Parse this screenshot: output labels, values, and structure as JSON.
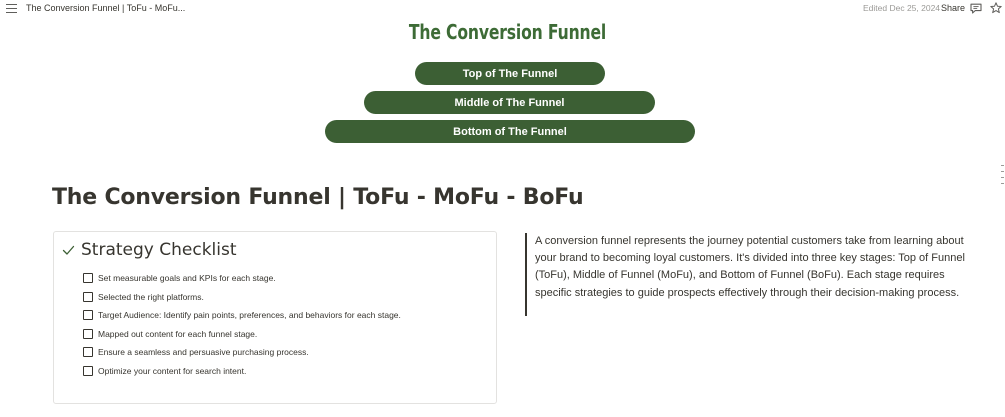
{
  "topbar": {
    "page_name": "The Conversion Funnel | ToFu - MoFu...",
    "edited": "Edited Dec 25, 2024",
    "share_label": "Share",
    "icons": [
      "menu-icon",
      "comment-icon",
      "star-icon"
    ]
  },
  "hero": {
    "title": "The Conversion Funnel",
    "funnel": {
      "top": "Top of The Funnel",
      "middle": "Middle of The Funnel",
      "bottom": "Bottom of The Funnel"
    }
  },
  "page": {
    "title": "The Conversion Funnel | ToFu - MoFu - BoFu"
  },
  "checklist": {
    "title": "Strategy Checklist",
    "items": [
      "Set measurable goals and KPIs for each stage.",
      "Selected the right platforms.",
      "Target Audience: Identify pain points, preferences, and behaviors for each stage.",
      "Mapped out content for each funnel stage.",
      "Ensure a seamless and persuasive purchasing process.",
      "Optimize your content for search intent."
    ]
  },
  "quote": {
    "text": "A conversion funnel represents the journey potential customers take from learning about your brand to becoming loyal customers. It's divided into three key stages: Top of Funnel (ToFu), Middle of Funnel (MoFu), and Bottom of Funnel (BoFu). Each stage requires specific strategies to guide prospects effectively through their decision-making process."
  },
  "colors": {
    "accent_green": "#3c5f34",
    "title_green": "#3d6b36",
    "text": "#37352f",
    "muted": "#9b9a97"
  }
}
